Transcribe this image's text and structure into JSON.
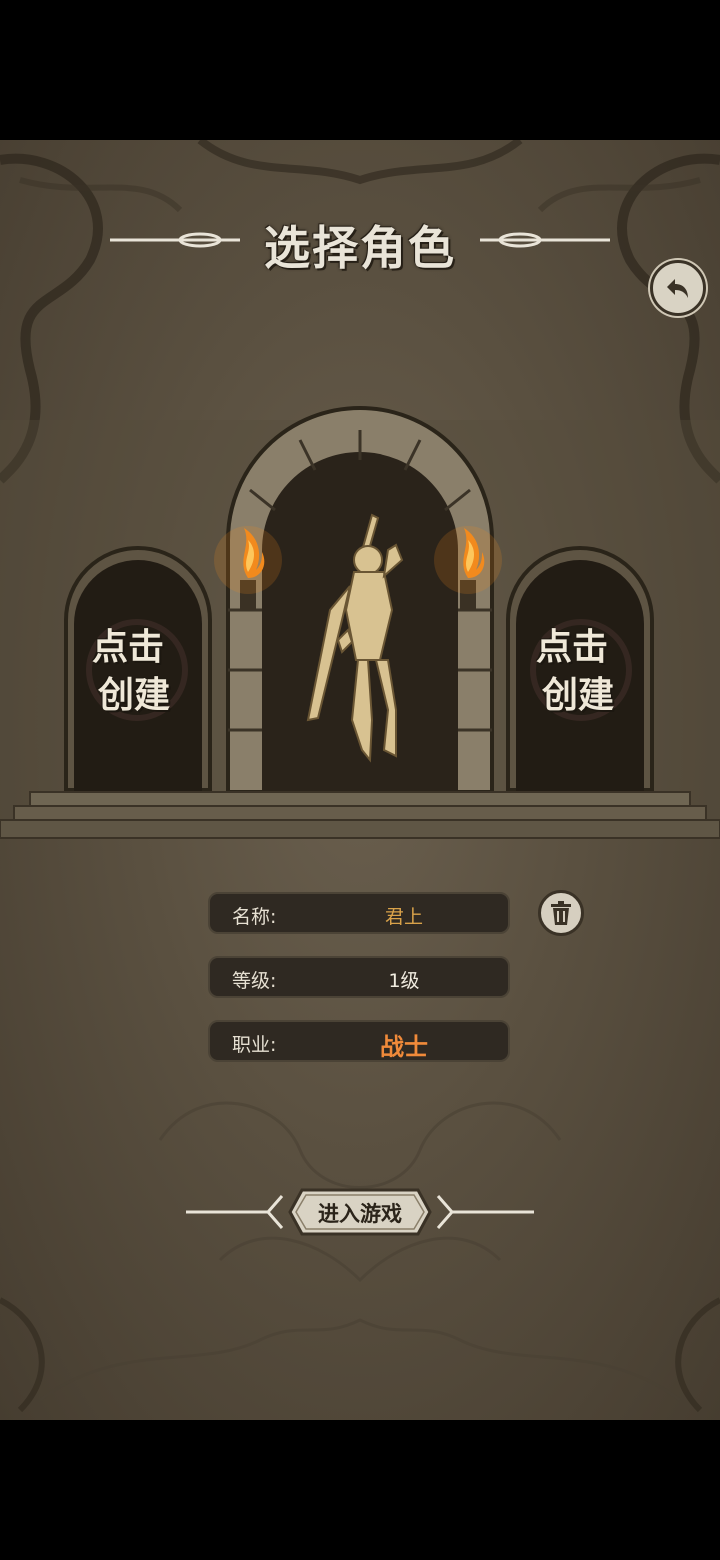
{
  "title": "选择角色",
  "slots": {
    "left_label_top": "点击",
    "left_label_bottom": "创建",
    "right_label_top": "点击",
    "right_label_bottom": "创建"
  },
  "character": {
    "name_label": "名称:",
    "name_value": "君上",
    "level_label": "等级:",
    "level_value": "1级",
    "class_label": "职业:",
    "class_value": "战士"
  },
  "buttons": {
    "enter_game": "进入游戏",
    "back_icon": "back-arrow-icon",
    "delete_icon": "trash-icon"
  },
  "colors": {
    "name_value": "#d9a24a",
    "class_value": "#f08a3a",
    "level_value": "#f1ece0",
    "flame": "#f28a1e"
  }
}
